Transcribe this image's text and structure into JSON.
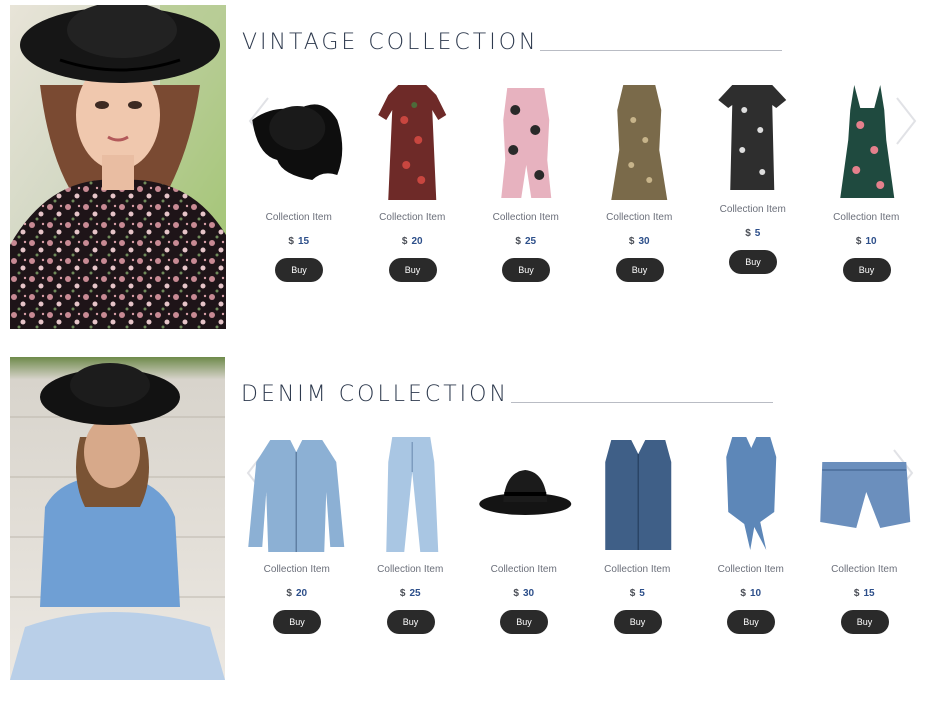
{
  "sections": [
    {
      "title": "VINTAGE COLLECTION",
      "items": [
        {
          "label": "Collection Item",
          "currency": "$",
          "price": "15",
          "buy": "Buy",
          "icon": "black-floppy-hat"
        },
        {
          "label": "Collection Item",
          "currency": "$",
          "price": "20",
          "buy": "Buy",
          "icon": "red-floral-maxi-dress"
        },
        {
          "label": "Collection Item",
          "currency": "$",
          "price": "25",
          "buy": "Buy",
          "icon": "pink-floral-romper"
        },
        {
          "label": "Collection Item",
          "currency": "$",
          "price": "30",
          "buy": "Buy",
          "icon": "olive-floral-dress"
        },
        {
          "label": "Collection Item",
          "currency": "$",
          "price": "5",
          "buy": "Buy",
          "icon": "black-floral-romper"
        },
        {
          "label": "Collection Item",
          "currency": "$",
          "price": "10",
          "buy": "Buy",
          "icon": "green-floral-dress"
        }
      ]
    },
    {
      "title": "DENIM COLLECTION",
      "items": [
        {
          "label": "Collection Item",
          "currency": "$",
          "price": "20",
          "buy": "Buy",
          "icon": "denim-jacket"
        },
        {
          "label": "Collection Item",
          "currency": "$",
          "price": "25",
          "buy": "Buy",
          "icon": "light-jeans"
        },
        {
          "label": "Collection Item",
          "currency": "$",
          "price": "30",
          "buy": "Buy",
          "icon": "black-wide-brim-hat"
        },
        {
          "label": "Collection Item",
          "currency": "$",
          "price": "5",
          "buy": "Buy",
          "icon": "denim-vest"
        },
        {
          "label": "Collection Item",
          "currency": "$",
          "price": "10",
          "buy": "Buy",
          "icon": "denim-tie-top"
        },
        {
          "label": "Collection Item",
          "currency": "$",
          "price": "15",
          "buy": "Buy",
          "icon": "denim-shorts"
        }
      ]
    }
  ]
}
